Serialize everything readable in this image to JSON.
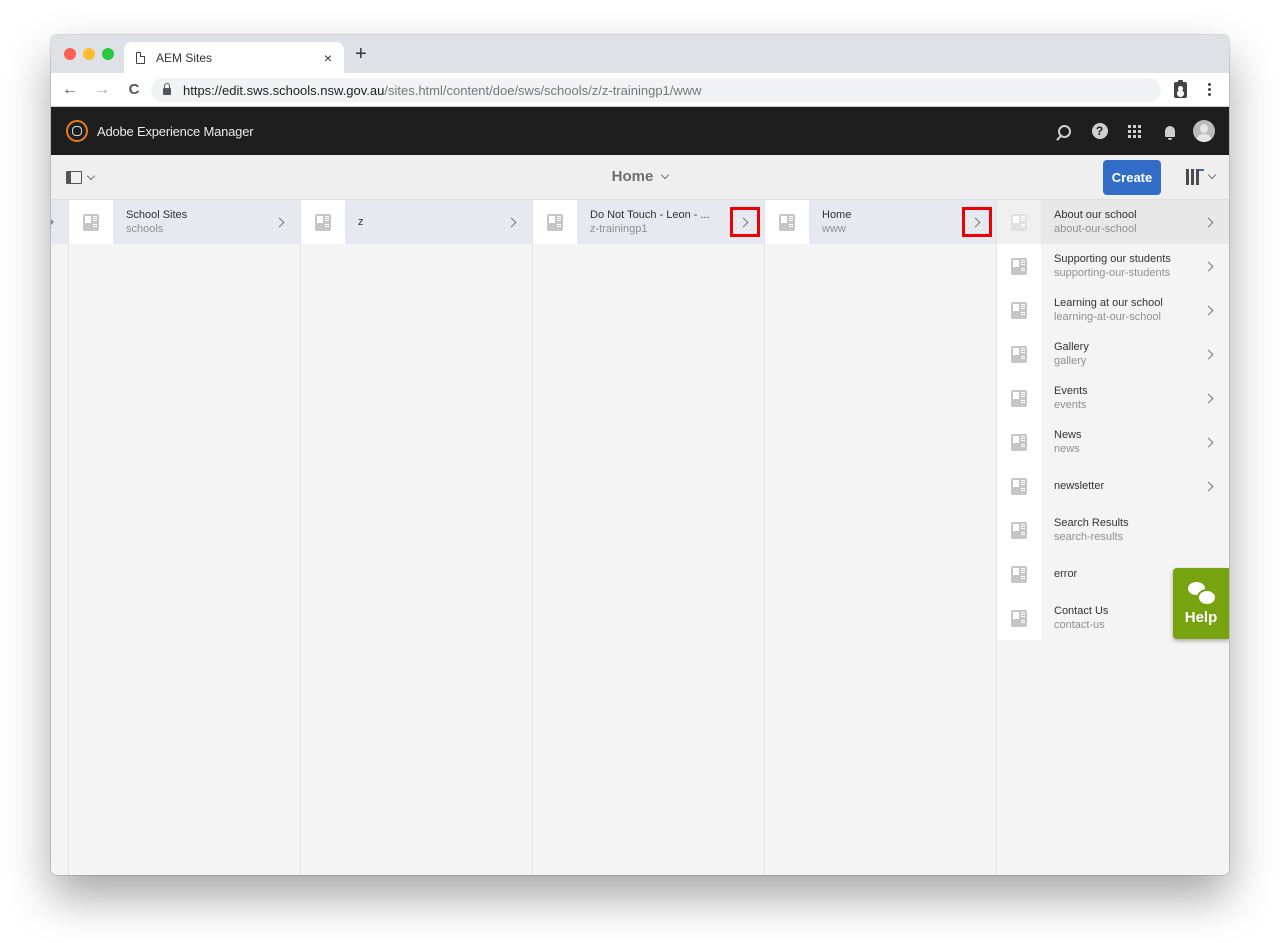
{
  "browser": {
    "tab_title": "AEM Sites",
    "tab_close": "×",
    "new_tab": "+",
    "url_host": "https://edit.sws.schools.nsw.gov.au",
    "url_path": "/sites.html/content/doe/sws/schools/z/z-trainingp1/www",
    "back": "←",
    "forward": "→",
    "reload": "C"
  },
  "header": {
    "app_title": "Adobe Experience Manager",
    "help_glyph": "?"
  },
  "actionbar": {
    "page_title": "Home",
    "create_label": "Create"
  },
  "columns": [
    {
      "items": [
        {
          "title": "School Sites",
          "name": "schools",
          "has_children": true,
          "active": true
        }
      ]
    },
    {
      "items": [
        {
          "title": "z",
          "name": "",
          "has_children": true,
          "active": true
        }
      ]
    },
    {
      "items": [
        {
          "title": "Do Not Touch - Leon - ...",
          "name": "z-trainingp1",
          "has_children": true,
          "active": true,
          "highlighted": true
        }
      ]
    },
    {
      "items": [
        {
          "title": "Home",
          "name": "www",
          "has_children": true,
          "active": true,
          "highlighted": true
        }
      ]
    },
    {
      "items": [
        {
          "title": "About our school",
          "name": "about-our-school",
          "has_children": true
        },
        {
          "title": "Supporting our students",
          "name": "supporting-our-students",
          "has_children": true
        },
        {
          "title": "Learning at our school",
          "name": "learning-at-our-school",
          "has_children": true
        },
        {
          "title": "Gallery",
          "name": "gallery",
          "has_children": true
        },
        {
          "title": "Events",
          "name": "events",
          "has_children": true
        },
        {
          "title": "News",
          "name": "news",
          "has_children": true
        },
        {
          "title": "newsletter",
          "name": "",
          "has_children": true
        },
        {
          "title": "Search Results",
          "name": "search-results",
          "has_children": false
        },
        {
          "title": "error",
          "name": "",
          "has_children": false
        },
        {
          "title": "Contact Us",
          "name": "contact-us",
          "has_children": false
        }
      ]
    }
  ],
  "help_widget": {
    "label": "Help",
    "color": "#76a30f"
  },
  "colors": {
    "accent": "#326ec8",
    "highlight": "#ee0000",
    "header_bg": "#1e1e1e"
  }
}
